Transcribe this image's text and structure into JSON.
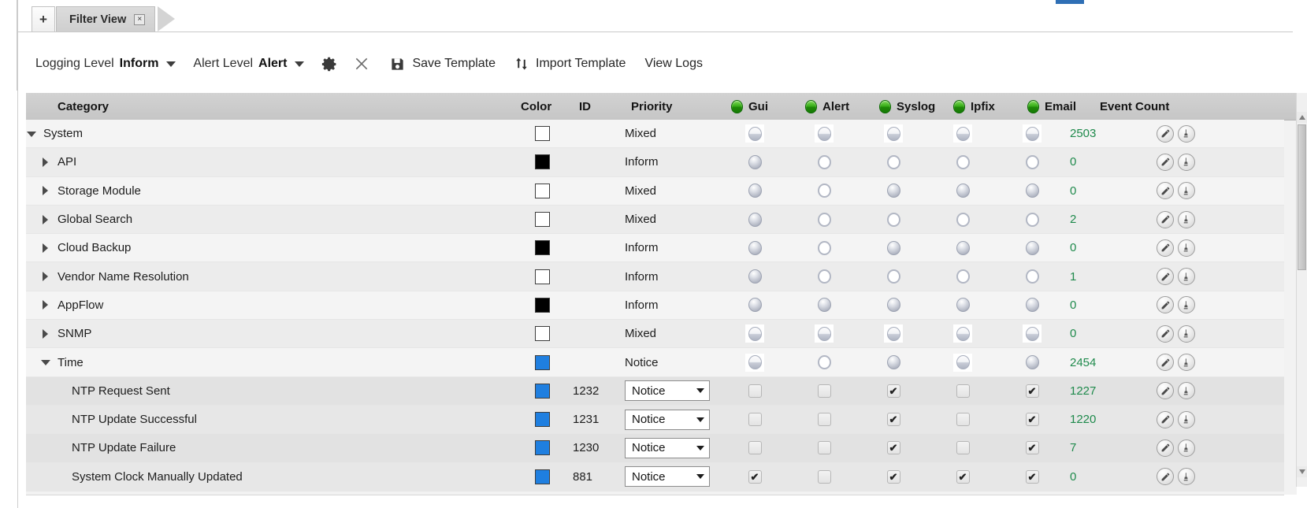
{
  "window": {
    "tab_add_label": "+",
    "tab_name": "Filter View",
    "tab_close_label": "×"
  },
  "toolbar": {
    "logging_level_label": "Logging Level",
    "logging_level_value": "Inform",
    "alert_level_label": "Alert Level",
    "alert_level_value": "Alert",
    "gear_title": "Settings",
    "close_title": "Close",
    "save_template_label": "Save Template",
    "import_template_label": "Import Template",
    "view_logs_label": "View Logs"
  },
  "colors": {
    "event_count_green": "#1f8a4c",
    "bulb_green": "#35ab16",
    "swatch_blue": "#1f7fe0",
    "swatch_black": "#000000",
    "swatch_white": "#ffffff"
  },
  "table": {
    "headers": {
      "category": "Category",
      "color": "Color",
      "id": "ID",
      "priority": "Priority",
      "gui": "Gui",
      "alert": "Alert",
      "syslog": "Syslog",
      "ipfix": "Ipfix",
      "email": "Email",
      "event_count": "Event Count"
    },
    "header_icons": {
      "gui": "green-bulb-icon",
      "alert": "green-bulb-icon",
      "syslog": "green-bulb-icon",
      "ipfix": "green-bulb-icon",
      "email": "green-bulb-icon"
    },
    "rows": [
      {
        "category": "System",
        "indent": 0,
        "expander": "down",
        "kind": "group",
        "color": "white",
        "id": "",
        "priority": "Mixed",
        "gui": "boxed-half",
        "alert": "boxed-half",
        "syslog": "boxed-half",
        "ipfix": "boxed-half",
        "email": "boxed-half",
        "event_count": "2503"
      },
      {
        "category": "API",
        "indent": 1,
        "expander": "right",
        "kind": "group",
        "color": "black",
        "id": "",
        "priority": "Inform",
        "gui": "filled",
        "alert": "empty",
        "syslog": "empty",
        "ipfix": "empty",
        "email": "empty",
        "event_count": "0"
      },
      {
        "category": "Storage Module",
        "indent": 1,
        "expander": "right",
        "kind": "group",
        "color": "white",
        "id": "",
        "priority": "Mixed",
        "gui": "filled",
        "alert": "empty",
        "syslog": "filled",
        "ipfix": "filled",
        "email": "filled",
        "event_count": "0"
      },
      {
        "category": "Global Search",
        "indent": 1,
        "expander": "right",
        "kind": "group",
        "color": "white",
        "id": "",
        "priority": "Mixed",
        "gui": "filled",
        "alert": "empty",
        "syslog": "empty",
        "ipfix": "empty",
        "email": "empty",
        "event_count": "2"
      },
      {
        "category": "Cloud Backup",
        "indent": 1,
        "expander": "right",
        "kind": "group",
        "color": "black",
        "id": "",
        "priority": "Inform",
        "gui": "filled",
        "alert": "empty",
        "syslog": "filled",
        "ipfix": "filled",
        "email": "filled",
        "event_count": "0"
      },
      {
        "category": "Vendor Name Resolution",
        "indent": 1,
        "expander": "right",
        "kind": "group",
        "color": "white",
        "id": "",
        "priority": "Inform",
        "gui": "filled",
        "alert": "empty",
        "syslog": "empty",
        "ipfix": "empty",
        "email": "empty",
        "event_count": "1"
      },
      {
        "category": "AppFlow",
        "indent": 1,
        "expander": "right",
        "kind": "group",
        "color": "black",
        "id": "",
        "priority": "Inform",
        "gui": "filled",
        "alert": "filled",
        "syslog": "filled",
        "ipfix": "filled",
        "email": "filled",
        "event_count": "0"
      },
      {
        "category": "SNMP",
        "indent": 1,
        "expander": "right",
        "kind": "group",
        "color": "white",
        "id": "",
        "priority": "Mixed",
        "gui": "boxed-half",
        "alert": "boxed-half",
        "syslog": "boxed-half",
        "ipfix": "boxed-half",
        "email": "boxed-half",
        "event_count": "0"
      },
      {
        "category": "Time",
        "indent": 1,
        "expander": "down",
        "kind": "group",
        "color": "blue",
        "id": "",
        "priority": "Notice",
        "gui": "boxed-half",
        "alert": "empty",
        "syslog": "filled",
        "ipfix": "boxed-half",
        "email": "filled",
        "event_count": "2454"
      },
      {
        "category": "NTP Request Sent",
        "indent": 2,
        "expander": "none",
        "kind": "leaf",
        "color": "blue",
        "id": "1232",
        "priority": "Notice",
        "gui": false,
        "alert": false,
        "syslog": true,
        "ipfix": false,
        "email": true,
        "event_count": "1227"
      },
      {
        "category": "NTP Update Successful",
        "indent": 2,
        "expander": "none",
        "kind": "leaf",
        "color": "blue",
        "id": "1231",
        "priority": "Notice",
        "gui": false,
        "alert": false,
        "syslog": true,
        "ipfix": false,
        "email": true,
        "event_count": "1220"
      },
      {
        "category": "NTP Update Failure",
        "indent": 2,
        "expander": "none",
        "kind": "leaf",
        "color": "blue",
        "id": "1230",
        "priority": "Notice",
        "gui": false,
        "alert": false,
        "syslog": true,
        "ipfix": false,
        "email": true,
        "event_count": "7"
      },
      {
        "category": "System Clock Manually Updated",
        "indent": 2,
        "expander": "none",
        "kind": "leaf",
        "color": "blue",
        "id": "881",
        "priority": "Notice",
        "gui": true,
        "alert": false,
        "syslog": true,
        "ipfix": true,
        "email": true,
        "event_count": "0"
      }
    ],
    "actions": {
      "edit": "pencil-icon",
      "clear": "brush-icon"
    }
  }
}
